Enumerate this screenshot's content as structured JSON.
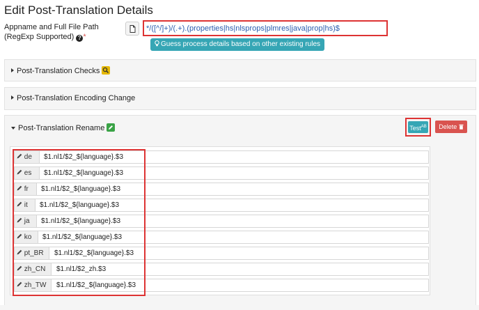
{
  "title": "Edit Post-Translation Details",
  "path_field": {
    "label_line1": "Appname and Full File Path",
    "label_line2": "(RegExp Supported)",
    "required_mark": "*",
    "value": "*/([^/]+)/(.+).(properties|hs|nlsprops|plmres|java|prop|hs)$"
  },
  "guess_button": "Guess process details based on other existing rules",
  "panels": {
    "checks": "Post-Translation Checks",
    "encoding": "Post-Translation Encoding Change",
    "rename": "Post-Translation Rename"
  },
  "buttons": {
    "test": "Test",
    "test_sup": "AB",
    "delete": "Delete"
  },
  "rename_rules": [
    {
      "lang": "de",
      "value": "$1.nl1/$2_${language}.$3"
    },
    {
      "lang": "es",
      "value": "$1.nl1/$2_${language}.$3"
    },
    {
      "lang": "fr",
      "value": "$1.nl1/$2_${language}.$3"
    },
    {
      "lang": "it",
      "value": "$1.nl1/$2_${language}.$3"
    },
    {
      "lang": "ja",
      "value": "$1.nl1/$2_${language}.$3"
    },
    {
      "lang": "ko",
      "value": "$1.nl1/$2_${language}.$3"
    },
    {
      "lang": "pt_BR",
      "value": "$1.nl1/$2_${language}.$3"
    },
    {
      "lang": "zh_CN",
      "value": "$1.nl1/$2_zh.$3"
    },
    {
      "lang": "zh_TW",
      "value": "$1.nl1/$2_${language}.$3"
    }
  ],
  "icons": {
    "help": "question-circle-icon",
    "file": "file-icon",
    "bulb": "lightbulb-icon",
    "search": "search-icon",
    "pencil": "pencil-icon",
    "trash": "trash-icon"
  },
  "colors": {
    "accent": "#36a6b5",
    "danger": "#d9534f",
    "highlight": "#dd3333",
    "edit_badge": "#3aa346",
    "search_badge": "#e6b800"
  }
}
